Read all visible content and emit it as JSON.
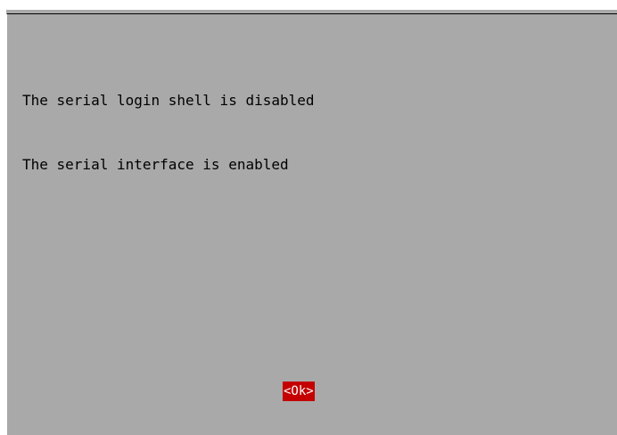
{
  "dialog": {
    "lines": [
      "The serial login shell is disabled",
      "The serial interface is enabled"
    ],
    "ok_label": "<Ok>"
  },
  "colors": {
    "dialog_background": "#a9a9a9",
    "button_background": "#c40000",
    "button_text": "#ffffff",
    "text": "#000000"
  }
}
